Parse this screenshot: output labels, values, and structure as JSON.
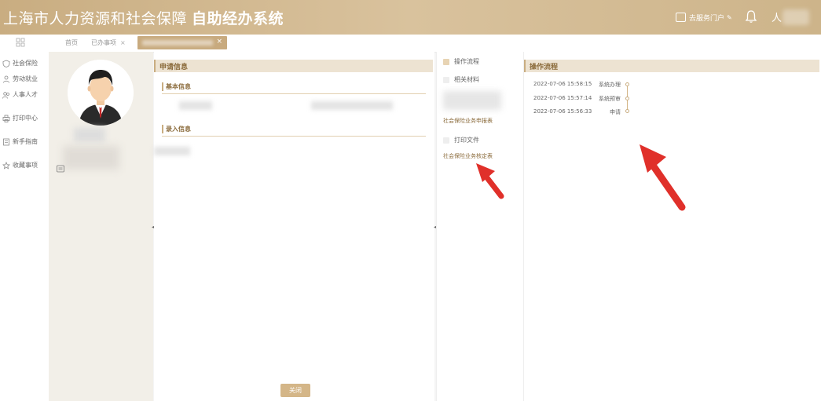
{
  "header": {
    "title_main": "上海市人力资源和社会保障",
    "title_sub": "自助经办系统",
    "portal_label": "去服务门户",
    "user_initial": "人"
  },
  "tabs": [
    {
      "label": "首页"
    },
    {
      "label": "已办事项"
    }
  ],
  "sidebar": {
    "items": [
      {
        "label": "社会保险",
        "icon": "shield-icon"
      },
      {
        "label": "劳动就业",
        "icon": "worker-icon"
      },
      {
        "label": "人事人才",
        "icon": "people-icon"
      },
      {
        "label": "打印中心",
        "icon": "printer-icon"
      },
      {
        "label": "新手指南",
        "icon": "guide-icon"
      },
      {
        "label": "收藏事项",
        "icon": "star-icon"
      }
    ]
  },
  "main": {
    "panel_title": "申请信息",
    "section_basic": "基本信息",
    "section_entry": "录入信息",
    "close_label": "关闭"
  },
  "middle": {
    "operation_flow": "操作流程",
    "related_materials": "相关材料",
    "application_form": "社会保险业务申报表",
    "print_files": "打印文件",
    "verification_form": "社会保险业务核定表"
  },
  "right": {
    "panel_title": "操作流程",
    "steps": [
      {
        "time": "2022-07-06 15:58:15",
        "name": "系统办理"
      },
      {
        "time": "2022-07-06 15:57:14",
        "name": "系统预审"
      },
      {
        "time": "2022-07-06 15:56:33",
        "name": "申请"
      }
    ]
  },
  "colors": {
    "header": "#cfb68c",
    "accent": "#c9ad81",
    "arrow": "#e0302a"
  }
}
